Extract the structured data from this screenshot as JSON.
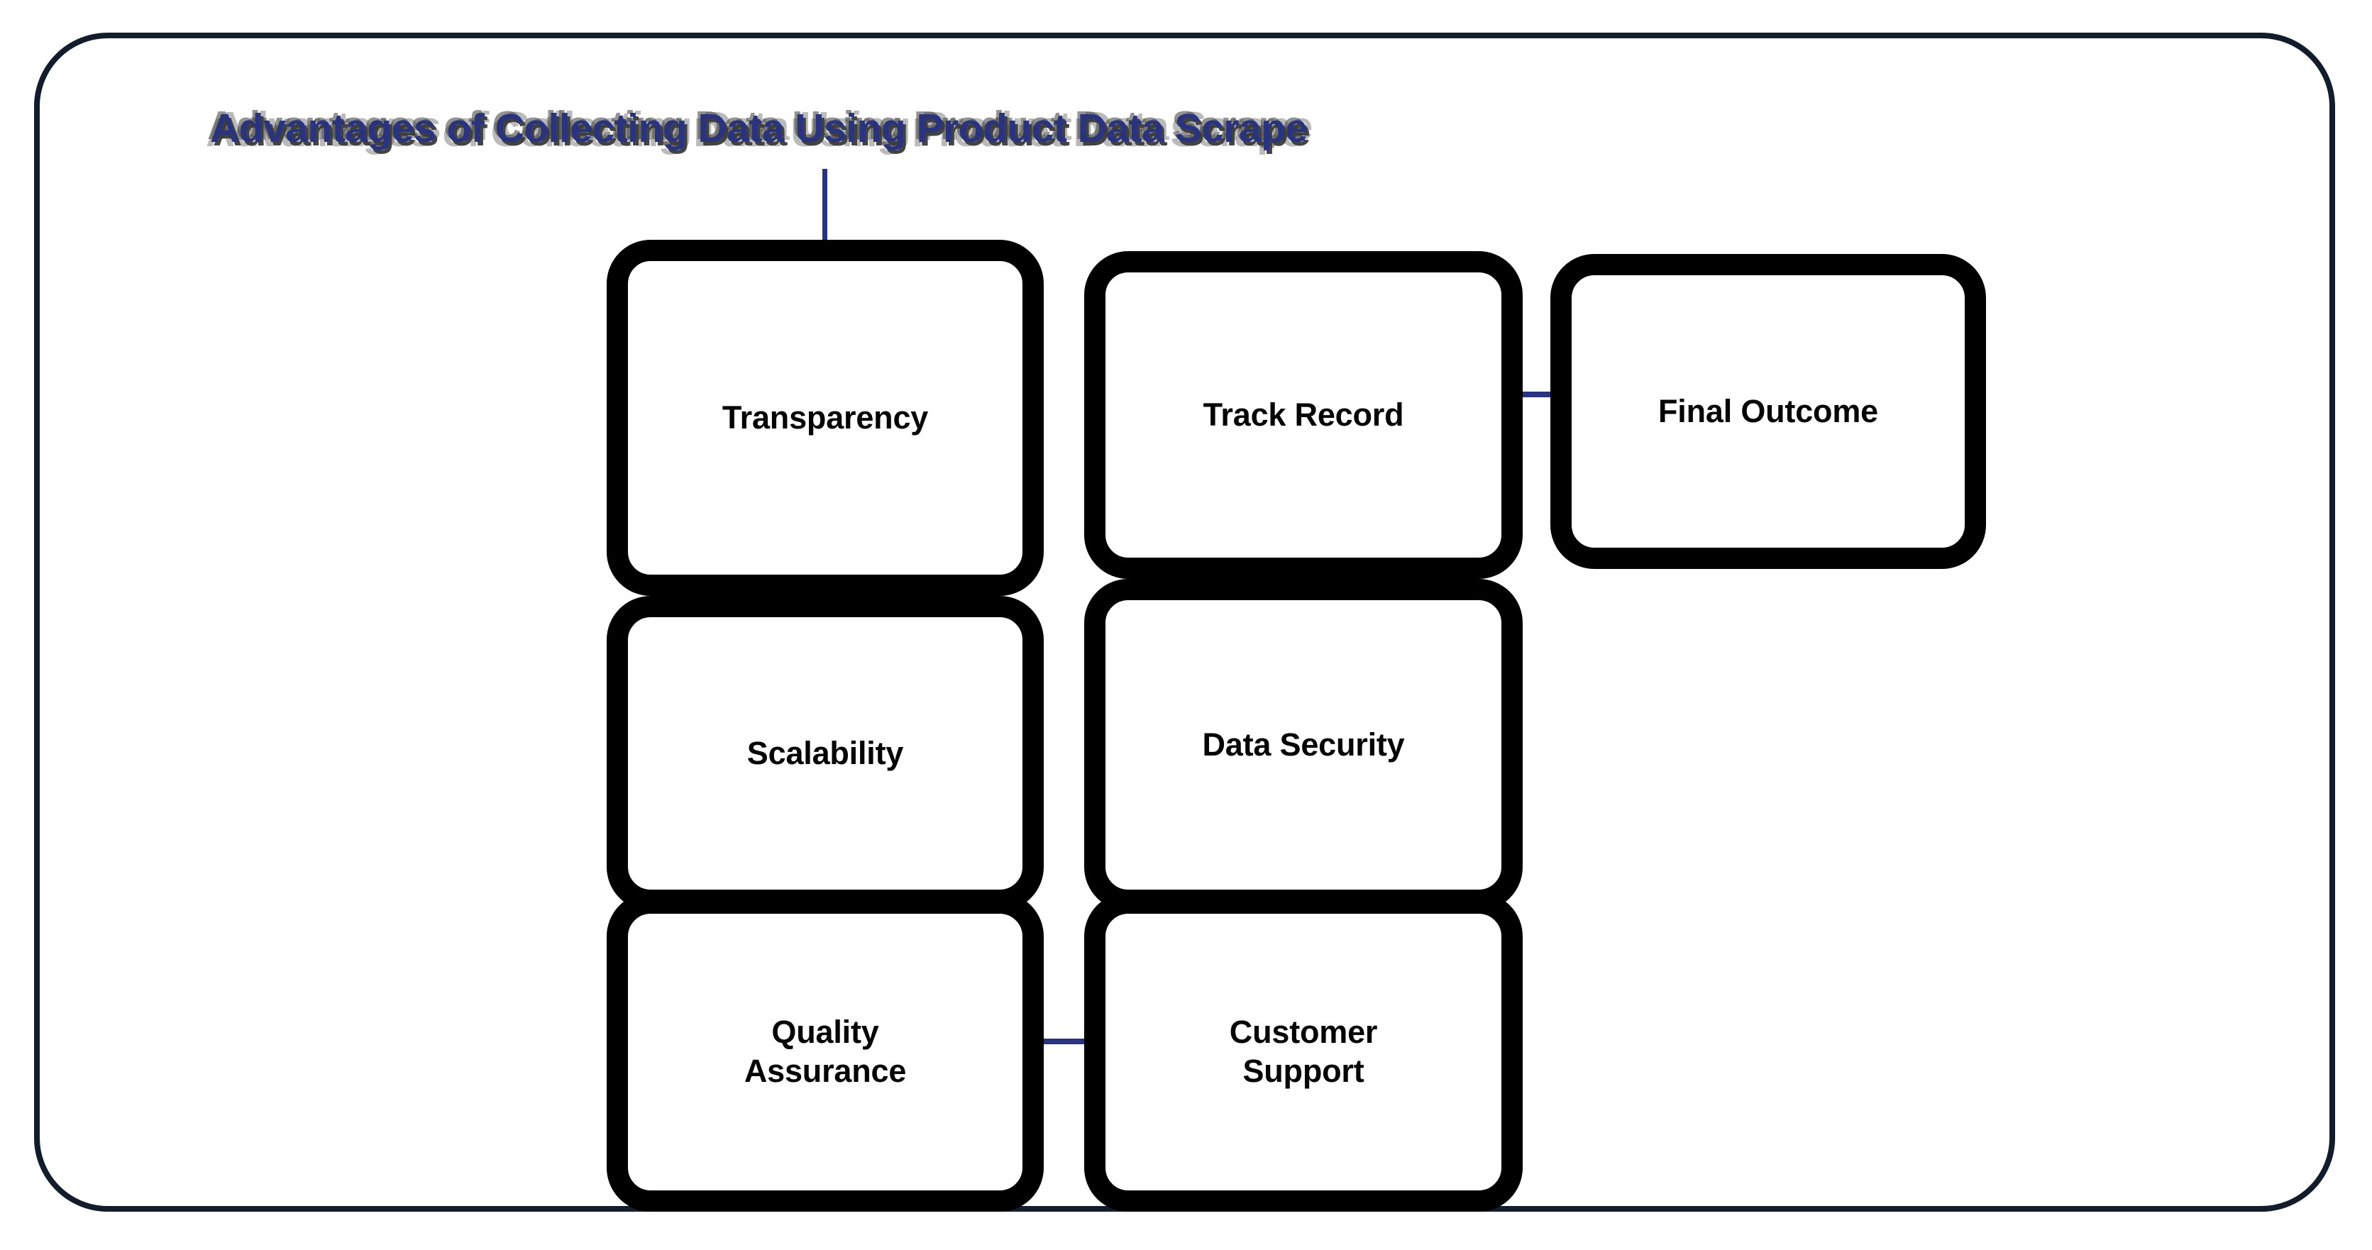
{
  "diagram": {
    "title": "Advantages of Collecting Data Using Product Data Scrape",
    "title_color": "#2a337e",
    "frame_color": "#131c2b",
    "node_border_color": "#000000",
    "node_fill_color": "#ffffff",
    "connector_color": "#2a3380",
    "type": "flowchart",
    "nodes": [
      {
        "id": "transparency",
        "label": "Transparency",
        "column": 1,
        "row": 1
      },
      {
        "id": "scalability",
        "label": "Scalability",
        "column": 1,
        "row": 2
      },
      {
        "id": "quality",
        "label": "Quality\nAssurance",
        "label_line1": "Quality",
        "label_line2": "Assurance",
        "column": 1,
        "row": 3
      },
      {
        "id": "track-record",
        "label": "Track Record",
        "column": 2,
        "row": 1
      },
      {
        "id": "data-security",
        "label": "Data Security",
        "column": 2,
        "row": 2
      },
      {
        "id": "customer",
        "label": "Customer\nSupport",
        "label_line1": "Customer",
        "label_line2": "Support",
        "column": 2,
        "row": 3
      },
      {
        "id": "final-outcome",
        "label": "Final Outcome",
        "column": 3,
        "row": 1
      }
    ],
    "connectors": [
      {
        "id": "title-to-transparency",
        "from": "title",
        "to": "transparency",
        "orientation": "vertical"
      },
      {
        "id": "column1-chain",
        "from": "transparency",
        "to": "quality",
        "orientation": "vertical"
      },
      {
        "id": "column2-chain",
        "from": "track-record",
        "to": "customer",
        "orientation": "vertical"
      },
      {
        "id": "track-to-final",
        "from": "track-record",
        "to": "final-outcome",
        "orientation": "horizontal"
      },
      {
        "id": "quality-to-customer",
        "from": "quality",
        "to": "customer",
        "orientation": "horizontal"
      }
    ]
  }
}
